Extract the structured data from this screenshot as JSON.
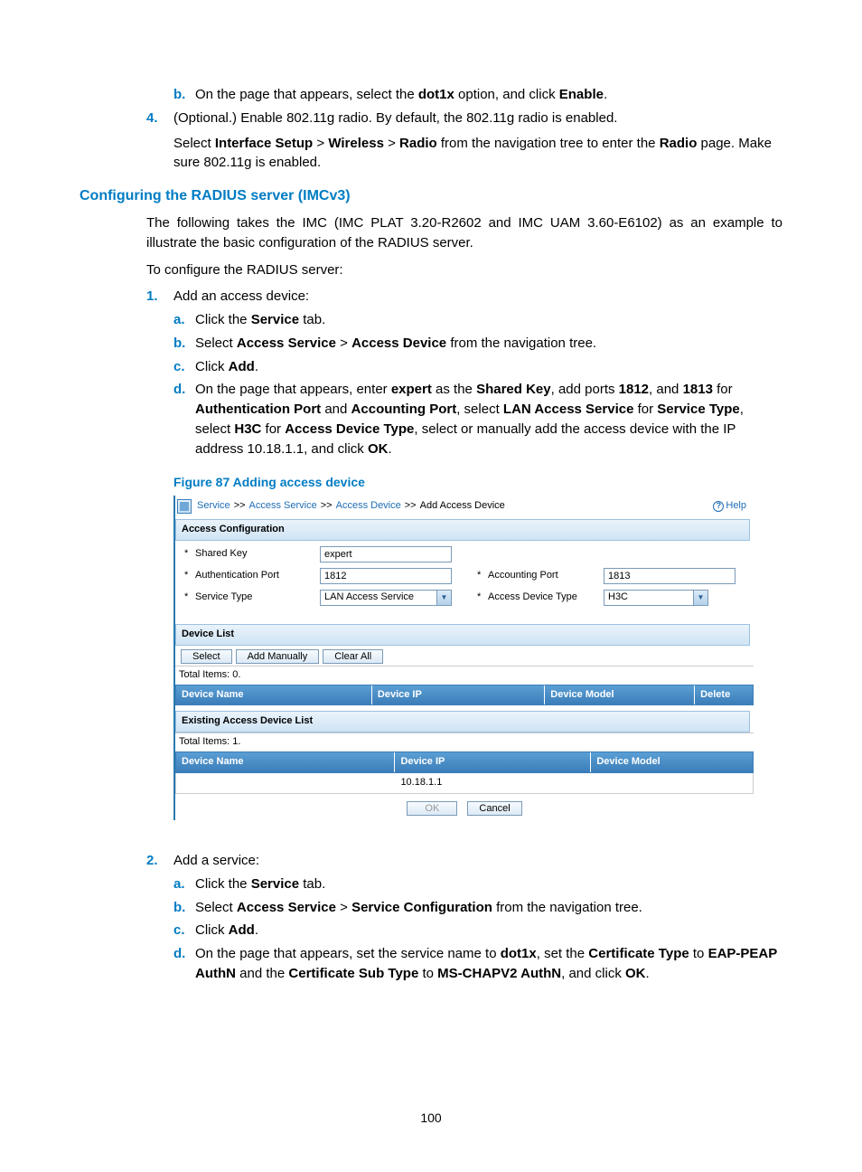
{
  "intro": {
    "b_text": "On the page that appears, select the ",
    "b_bold1": "dot1x",
    "b_mid": " option, and click ",
    "b_bold2": "Enable",
    "b_end": ".",
    "step4_num": "4.",
    "step4_text": "(Optional.) Enable 802.11g radio. By default, the 802.11g radio is enabled.",
    "step4_para_a": "Select ",
    "step4_b1": "Interface Setup",
    "step4_gt1": " > ",
    "step4_b2": "Wireless",
    "step4_gt2": " > ",
    "step4_b3": "Radio",
    "step4_mid": " from the navigation tree to enter the ",
    "step4_b4": "Radio",
    "step4_end": " page. Make sure 802.11g is enabled."
  },
  "h3": "Configuring the RADIUS server (IMCv3)",
  "para1": "The following takes the IMC (IMC PLAT 3.20-R2602 and IMC UAM 3.60-E6102) as an example to illustrate the basic configuration of the RADIUS server.",
  "para2": "To configure the RADIUS server:",
  "list": {
    "step1_num": "1.",
    "step1_text": "Add an access device:",
    "step1a_l": "a.",
    "step1a_a": "Click the ",
    "step1a_b": "Service",
    "step1a_c": " tab.",
    "step1b_l": "b.",
    "step1b_a": "Select ",
    "step1b_b1": "Access Service",
    "step1b_gt": " > ",
    "step1b_b2": "Access Device",
    "step1b_c": " from the navigation tree.",
    "step1c_l": "c.",
    "step1c_a": "Click ",
    "step1c_b": "Add",
    "step1c_c": ".",
    "step1d_l": "d.",
    "step1d_a": "On the page that appears, enter ",
    "step1d_b1": "expert",
    "step1d_mid1": " as the ",
    "step1d_b2": "Shared Key",
    "step1d_mid2": ", add ports ",
    "step1d_b3": "1812",
    "step1d_mid3": ", and ",
    "step1d_b4": "1813",
    "step1d_mid4": " for ",
    "step1d_b5": "Authentication Port",
    "step1d_mid5": " and ",
    "step1d_b6": "Accounting Port",
    "step1d_mid6": ", select ",
    "step1d_b7": "LAN Access Service",
    "step1d_mid7": " for ",
    "step1d_b8": "Service Type",
    "step1d_mid8": ", select ",
    "step1d_b9": "H3C",
    "step1d_mid9": " for ",
    "step1d_b10": "Access Device Type",
    "step1d_mid10": ", select or manually add the access device with the IP address 10.18.1.1, and click ",
    "step1d_b11": "OK",
    "step1d_end": ".",
    "step2_num": "2.",
    "step2_text": "Add a service:",
    "step2a_l": "a.",
    "step2a_a": "Click the ",
    "step2a_b": "Service",
    "step2a_c": " tab.",
    "step2b_l": "b.",
    "step2b_a": "Select ",
    "step2b_b1": "Access Service",
    "step2b_gt": " > ",
    "step2b_b2": "Service Configuration",
    "step2b_c": " from the navigation tree.",
    "step2c_l": "c.",
    "step2c_a": "Click ",
    "step2c_b": "Add",
    "step2c_c": ".",
    "step2d_l": "d.",
    "step2d_a": "On the page that appears, set the service name to ",
    "step2d_b1": "dot1x",
    "step2d_mid1": ", set the ",
    "step2d_b2": "Certificate Type",
    "step2d_mid2": " to ",
    "step2d_b3": "EAP-PEAP AuthN",
    "step2d_mid3": " and the ",
    "step2d_b4": "Certificate Sub Type",
    "step2d_mid4": " to ",
    "step2d_b5": "MS-CHAPV2 AuthN",
    "step2d_mid5": ", and click ",
    "step2d_b6": "OK",
    "step2d_end": "."
  },
  "figcap": "Figure 87 Adding access device",
  "fig": {
    "bc_service": "Service",
    "bc_access_service": "Access Service",
    "bc_access_device": "Access Device",
    "bc_current": "Add Access Device",
    "bc_sep": ">>",
    "help": "Help",
    "sec_access_conf": "Access Configuration",
    "lbl_shared_key": "Shared Key",
    "val_shared_key": "expert",
    "lbl_auth_port": "Authentication Port",
    "val_auth_port": "1812",
    "lbl_acct_port": "Accounting Port",
    "val_acct_port": "1813",
    "lbl_service_type": "Service Type",
    "val_service_type": "LAN Access Service",
    "lbl_device_type": "Access Device Type",
    "val_device_type": "H3C",
    "sec_device_list": "Device List",
    "btn_select": "Select",
    "btn_add_manually": "Add Manually",
    "btn_clear_all": "Clear All",
    "total0": "Total Items: 0.",
    "hdr_device_name": "Device Name",
    "hdr_device_ip": "Device IP",
    "hdr_device_model": "Device Model",
    "hdr_delete": "Delete",
    "sec_existing": "Existing Access Device List",
    "total1": "Total Items: 1.",
    "row_ip": "10.18.1.1",
    "btn_ok": "OK",
    "btn_cancel": "Cancel"
  },
  "page_number": "100"
}
